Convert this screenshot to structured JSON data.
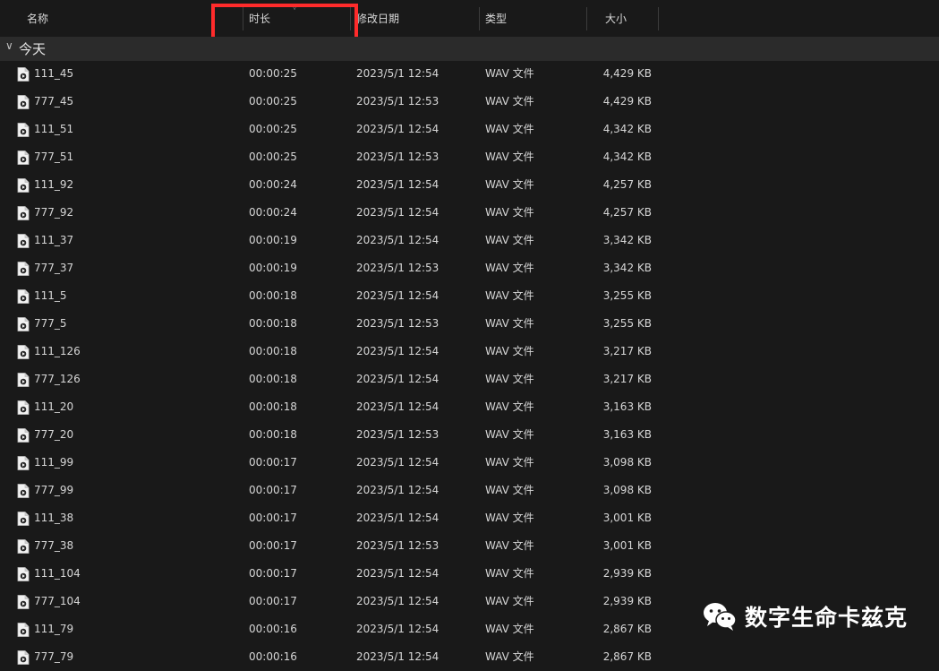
{
  "columns": {
    "name": "名称",
    "duration": "时长",
    "modified": "修改日期",
    "type": "类型",
    "size": "大小"
  },
  "group": {
    "label": "今天"
  },
  "files": [
    {
      "name": "111_45",
      "duration": "00:00:25",
      "modified": "2023/5/1 12:54",
      "type": "WAV 文件",
      "size": "4,429 KB"
    },
    {
      "name": "777_45",
      "duration": "00:00:25",
      "modified": "2023/5/1 12:53",
      "type": "WAV 文件",
      "size": "4,429 KB"
    },
    {
      "name": "111_51",
      "duration": "00:00:25",
      "modified": "2023/5/1 12:54",
      "type": "WAV 文件",
      "size": "4,342 KB"
    },
    {
      "name": "777_51",
      "duration": "00:00:25",
      "modified": "2023/5/1 12:53",
      "type": "WAV 文件",
      "size": "4,342 KB"
    },
    {
      "name": "111_92",
      "duration": "00:00:24",
      "modified": "2023/5/1 12:54",
      "type": "WAV 文件",
      "size": "4,257 KB"
    },
    {
      "name": "777_92",
      "duration": "00:00:24",
      "modified": "2023/5/1 12:54",
      "type": "WAV 文件",
      "size": "4,257 KB"
    },
    {
      "name": "111_37",
      "duration": "00:00:19",
      "modified": "2023/5/1 12:54",
      "type": "WAV 文件",
      "size": "3,342 KB"
    },
    {
      "name": "777_37",
      "duration": "00:00:19",
      "modified": "2023/5/1 12:53",
      "type": "WAV 文件",
      "size": "3,342 KB"
    },
    {
      "name": "111_5",
      "duration": "00:00:18",
      "modified": "2023/5/1 12:54",
      "type": "WAV 文件",
      "size": "3,255 KB"
    },
    {
      "name": "777_5",
      "duration": "00:00:18",
      "modified": "2023/5/1 12:53",
      "type": "WAV 文件",
      "size": "3,255 KB"
    },
    {
      "name": "111_126",
      "duration": "00:00:18",
      "modified": "2023/5/1 12:54",
      "type": "WAV 文件",
      "size": "3,217 KB"
    },
    {
      "name": "777_126",
      "duration": "00:00:18",
      "modified": "2023/5/1 12:54",
      "type": "WAV 文件",
      "size": "3,217 KB"
    },
    {
      "name": "111_20",
      "duration": "00:00:18",
      "modified": "2023/5/1 12:54",
      "type": "WAV 文件",
      "size": "3,163 KB"
    },
    {
      "name": "777_20",
      "duration": "00:00:18",
      "modified": "2023/5/1 12:53",
      "type": "WAV 文件",
      "size": "3,163 KB"
    },
    {
      "name": "111_99",
      "duration": "00:00:17",
      "modified": "2023/5/1 12:54",
      "type": "WAV 文件",
      "size": "3,098 KB"
    },
    {
      "name": "777_99",
      "duration": "00:00:17",
      "modified": "2023/5/1 12:54",
      "type": "WAV 文件",
      "size": "3,098 KB"
    },
    {
      "name": "111_38",
      "duration": "00:00:17",
      "modified": "2023/5/1 12:54",
      "type": "WAV 文件",
      "size": "3,001 KB"
    },
    {
      "name": "777_38",
      "duration": "00:00:17",
      "modified": "2023/5/1 12:53",
      "type": "WAV 文件",
      "size": "3,001 KB"
    },
    {
      "name": "111_104",
      "duration": "00:00:17",
      "modified": "2023/5/1 12:54",
      "type": "WAV 文件",
      "size": "2,939 KB"
    },
    {
      "name": "777_104",
      "duration": "00:00:17",
      "modified": "2023/5/1 12:54",
      "type": "WAV 文件",
      "size": "2,939 KB"
    },
    {
      "name": "111_79",
      "duration": "00:00:16",
      "modified": "2023/5/1 12:54",
      "type": "WAV 文件",
      "size": "2,867 KB"
    },
    {
      "name": "777_79",
      "duration": "00:00:16",
      "modified": "2023/5/1 12:54",
      "type": "WAV 文件",
      "size": "2,867 KB"
    }
  ],
  "watermark": {
    "text": "数字生命卡兹克",
    "icon": "wechat-icon"
  },
  "colors": {
    "background": "#191919",
    "group_band": "#2b2b2b",
    "highlight": "#ff2b2b",
    "text": "#d9d9d9"
  }
}
